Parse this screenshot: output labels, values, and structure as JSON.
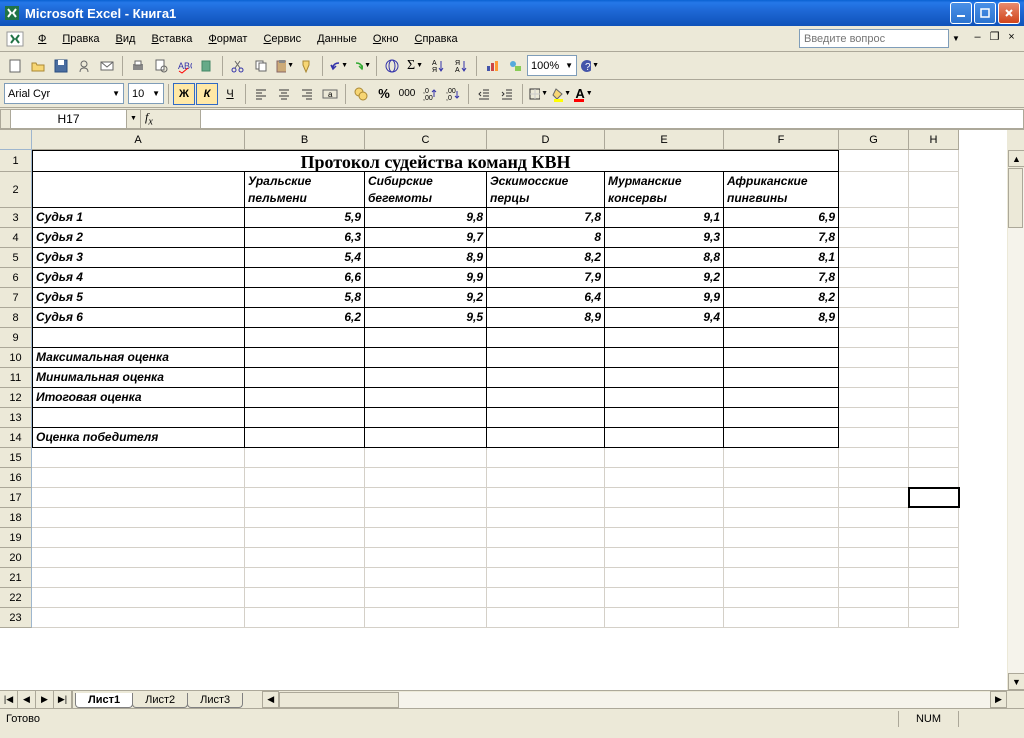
{
  "titlebar": {
    "title": "Microsoft Excel - Книга1"
  },
  "menu": {
    "file": "Файл",
    "edit": "Правка",
    "view": "Вид",
    "insert": "Вставка",
    "format": "Формат",
    "tools": "Сервис",
    "data": "Данные",
    "window": "Окно",
    "help": "Справка"
  },
  "helpbox": {
    "placeholder": "Введите вопрос"
  },
  "toolbar": {
    "zoom": "100%"
  },
  "format": {
    "font": "Arial Cyr",
    "size": "10"
  },
  "namebox": "H17",
  "columns": [
    "A",
    "B",
    "C",
    "D",
    "E",
    "F",
    "G",
    "H"
  ],
  "rows": [
    "1",
    "2",
    "3",
    "4",
    "5",
    "6",
    "7",
    "8",
    "9",
    "10",
    "11",
    "12",
    "13",
    "14",
    "15",
    "16",
    "17",
    "18",
    "19",
    "20",
    "21",
    "22",
    "23"
  ],
  "content": {
    "title": "Протокол судейства команд КВН",
    "headers": [
      "",
      "Уральские пельмени",
      "Сибирские бегемоты",
      "Эскимосские перцы",
      "Мурманские консервы",
      "Африканские пингвины"
    ],
    "judges": [
      {
        "name": "Судья 1",
        "v": [
          "5,9",
          "9,8",
          "7,8",
          "9,1",
          "6,9"
        ]
      },
      {
        "name": "Судья 2",
        "v": [
          "6,3",
          "9,7",
          "8",
          "9,3",
          "7,8"
        ]
      },
      {
        "name": "Судья 3",
        "v": [
          "5,4",
          "8,9",
          "8,2",
          "8,8",
          "8,1"
        ]
      },
      {
        "name": "Судья 4",
        "v": [
          "6,6",
          "9,9",
          "7,9",
          "9,2",
          "7,8"
        ]
      },
      {
        "name": "Судья 5",
        "v": [
          "5,8",
          "9,2",
          "6,4",
          "9,9",
          "8,2"
        ]
      },
      {
        "name": "Судья 6",
        "v": [
          "6,2",
          "9,5",
          "8,9",
          "9,4",
          "8,9"
        ]
      }
    ],
    "summary": [
      "Максимальная оценка",
      "Минимальная оценка",
      "Итоговая оценка",
      "",
      "Оценка победителя"
    ]
  },
  "sheets": [
    "Лист1",
    "Лист2",
    "Лист3"
  ],
  "status": {
    "ready": "Готово",
    "num": "NUM"
  }
}
